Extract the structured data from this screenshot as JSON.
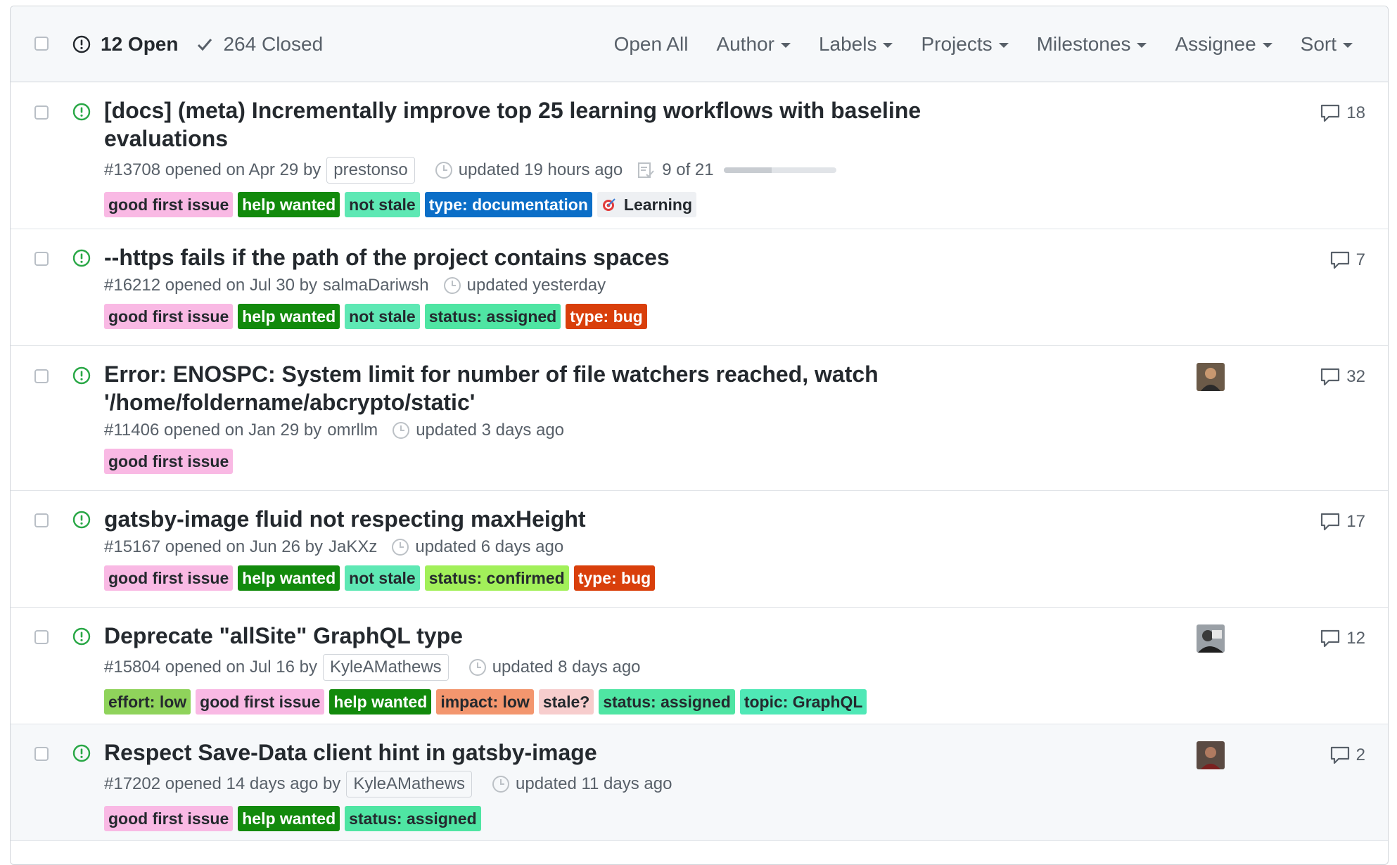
{
  "header": {
    "open_label": "12 Open",
    "closed_label": "264 Closed",
    "filters": [
      "Open All",
      "Author",
      "Labels",
      "Projects",
      "Milestones",
      "Assignee",
      "Sort"
    ]
  },
  "label_colors": {
    "good first issue": {
      "bg": "#f9b9e4",
      "fg": "#24292e"
    },
    "help wanted": {
      "bg": "#128a0c",
      "fg": "#ffffff"
    },
    "not stale": {
      "bg": "#5ee8b4",
      "fg": "#24292e"
    },
    "type: documentation": {
      "bg": "#0b6ec7",
      "fg": "#ffffff"
    },
    "Learning": {
      "bg": "#eef0f3",
      "fg": "#24292e"
    },
    "status: assigned": {
      "bg": "#4fe5a3",
      "fg": "#24292e"
    },
    "type: bug": {
      "bg": "#d93f0b",
      "fg": "#ffffff"
    },
    "status: confirmed": {
      "bg": "#a2f05a",
      "fg": "#24292e"
    },
    "effort: low": {
      "bg": "#8fd35b",
      "fg": "#24292e"
    },
    "impact: low": {
      "bg": "#f3966e",
      "fg": "#24292e"
    },
    "stale?": {
      "bg": "#f7cdcd",
      "fg": "#24292e"
    },
    "topic: GraphQL": {
      "bg": "#4fe8b6",
      "fg": "#24292e"
    }
  },
  "issues": [
    {
      "title": "[docs] (meta) Incrementally improve top 25 learning workflows with baseline evaluations",
      "number": "#13708",
      "opened": "opened on Apr 29 by",
      "author": "prestonso",
      "author_boxed": true,
      "updated": "updated 19 hours ago",
      "tasks": "9 of 21",
      "task_progress": 0.43,
      "labels": [
        "good first issue",
        "help wanted",
        "not stale",
        "type: documentation",
        "Learning"
      ],
      "comments": "18",
      "avatar": null
    },
    {
      "title": "--https fails if the path of the project contains spaces",
      "number": "#16212",
      "opened": "opened on Jul 30 by",
      "author": "salmaDariwsh",
      "author_boxed": false,
      "updated": "updated yesterday",
      "labels": [
        "good first issue",
        "help wanted",
        "not stale",
        "status: assigned",
        "type: bug"
      ],
      "comments": "7",
      "avatar": null
    },
    {
      "title": "Error: ENOSPC: System limit for number of file watchers reached, watch '/home/foldername/abcrypto/static'",
      "number": "#11406",
      "opened": "opened on Jan 29 by",
      "author": "omrllm",
      "author_boxed": false,
      "updated": "updated 3 days ago",
      "labels": [
        "good first issue"
      ],
      "comments": "32",
      "avatar": "person-1"
    },
    {
      "title": "gatsby-image fluid not respecting maxHeight",
      "number": "#15167",
      "opened": "opened on Jun 26 by",
      "author": "JaKXz",
      "author_boxed": false,
      "updated": "updated 6 days ago",
      "labels": [
        "good first issue",
        "help wanted",
        "not stale",
        "status: confirmed",
        "type: bug"
      ],
      "comments": "17",
      "avatar": null
    },
    {
      "title": "Deprecate \"allSite\" GraphQL type",
      "number": "#15804",
      "opened": "opened on Jul 16 by",
      "author": "KyleAMathews",
      "author_boxed": true,
      "updated": "updated 8 days ago",
      "labels": [
        "effort: low",
        "good first issue",
        "help wanted",
        "impact: low",
        "stale?",
        "status: assigned",
        "topic: GraphQL"
      ],
      "comments": "12",
      "avatar": "person-2"
    },
    {
      "title": "Respect Save-Data client hint in gatsby-image",
      "number": "#17202",
      "opened": "opened 14 days ago by",
      "author": "KyleAMathews",
      "author_boxed": true,
      "updated": "updated 11 days ago",
      "labels": [
        "good first issue",
        "help wanted",
        "status: assigned"
      ],
      "comments": "2",
      "avatar": "person-3"
    }
  ]
}
